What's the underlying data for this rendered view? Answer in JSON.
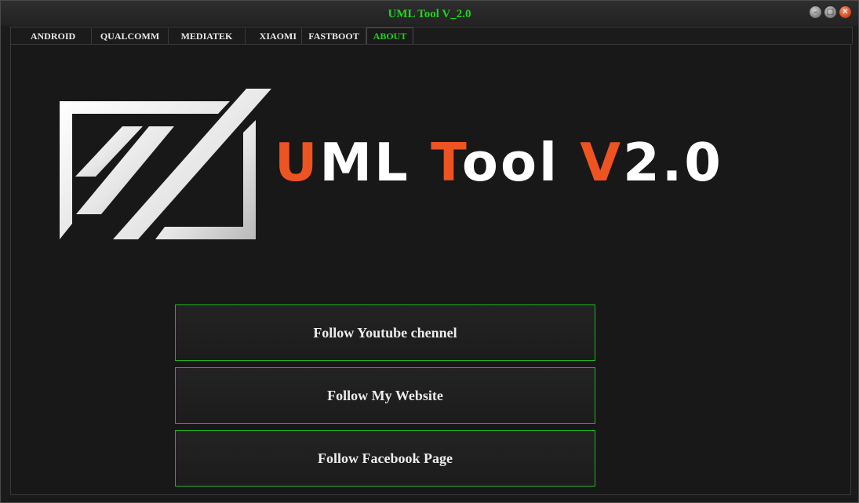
{
  "window": {
    "title": "UML Tool V_2.0",
    "controls": {
      "minimize": "–",
      "maximize": "□",
      "close": "✕"
    }
  },
  "tabs": [
    {
      "label": "ANDROID",
      "active": false
    },
    {
      "label": "QUALCOMM",
      "active": false
    },
    {
      "label": "MEDIATEK",
      "active": false
    },
    {
      "label": "XIAOMI",
      "active": false
    },
    {
      "label": "FASTBOOT",
      "active": false
    },
    {
      "label": "ABOUT",
      "active": true
    }
  ],
  "about": {
    "logo": {
      "u": "U",
      "ml": "ML ",
      "t": "T",
      "ool": "ool ",
      "v": "V",
      "version": "2.0"
    },
    "buttons": {
      "youtube": "Follow Youtube chennel",
      "website": "Follow My Website",
      "facebook": "Follow Facebook Page"
    }
  },
  "colors": {
    "title_green": "#21d321",
    "button_border": "#21b321",
    "logo_orange": "#ee5322",
    "logo_white": "#ffffff",
    "background": "#181818"
  },
  "icons": [
    "minimize-icon",
    "maximize-icon",
    "close-icon",
    "uml-logo-emblem"
  ]
}
